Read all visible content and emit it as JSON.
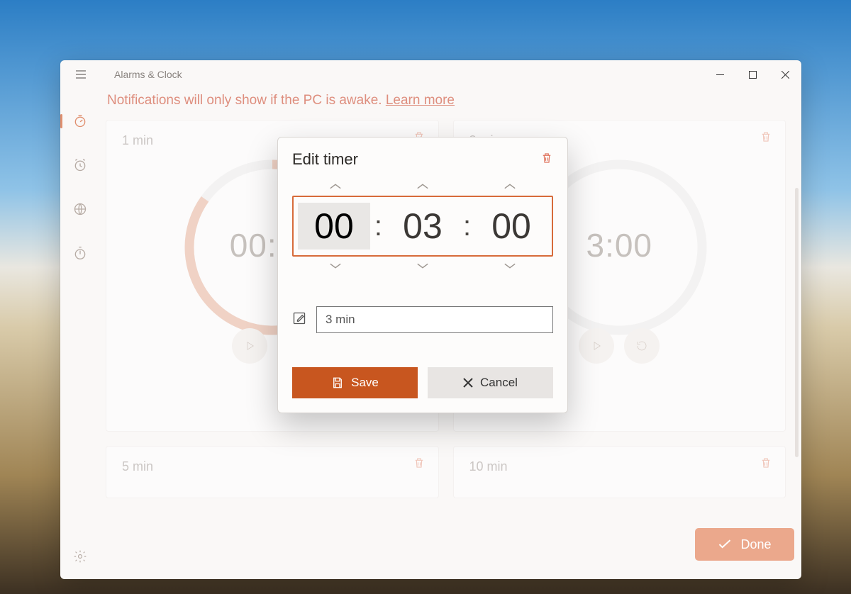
{
  "colors": {
    "accent": "#c8561f",
    "accent_light": "#e8b49e",
    "done": "#eba88c",
    "banner_text": "#de8e7e"
  },
  "titlebar": {
    "app_name": "Alarms & Clock"
  },
  "banner": {
    "text": "Notifications will only show if the PC is awake. ",
    "link_text": "Learn more"
  },
  "nav": {
    "items": [
      {
        "id": "timer",
        "active": true
      },
      {
        "id": "alarm",
        "active": false
      },
      {
        "id": "world-clock",
        "active": false
      },
      {
        "id": "stopwatch",
        "active": false
      }
    ],
    "settings": "settings"
  },
  "timers_top": [
    {
      "label": "1 min",
      "display": "00:00"
    },
    {
      "label": "3 min",
      "display": "3:00"
    }
  ],
  "timers_bottom": [
    {
      "label": "5 min"
    },
    {
      "label": "10 min"
    }
  ],
  "modal": {
    "title": "Edit timer",
    "hours": "00",
    "minutes": "03",
    "seconds": "00",
    "name_value": "3 min",
    "save_label": "Save",
    "cancel_label": "Cancel"
  },
  "done_label": "Done"
}
